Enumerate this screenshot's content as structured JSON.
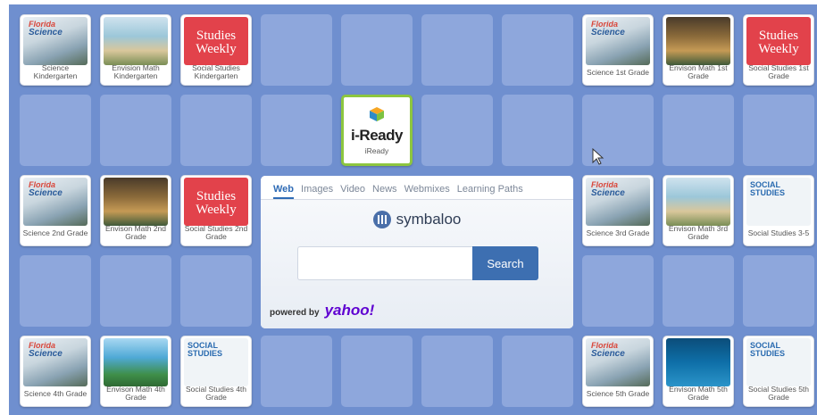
{
  "tiles": {
    "r1c1": {
      "label": "Science Kindergarten",
      "book_brand": "Florida",
      "book_subject": "Science"
    },
    "r1c2": {
      "label": "Envision Math Kindergarten"
    },
    "r1c3": {
      "label": "Social Studies Kindergarten",
      "logo_text": "Studies Weekly"
    },
    "r1c8": {
      "label": "Science 1st Grade",
      "book_brand": "Florida",
      "book_subject": "Science"
    },
    "r1c9": {
      "label": "Envison Math 1st Grade"
    },
    "r1c10": {
      "label": "Social Studies 1st Grade",
      "logo_text": "Studies Weekly"
    },
    "r2c5": {
      "label": "iReady",
      "logo_text": "i-Ready"
    },
    "r3c1": {
      "label": "Science 2nd Grade",
      "book_brand": "Florida",
      "book_subject": "Science"
    },
    "r3c2": {
      "label": "Envison Math 2nd Grade"
    },
    "r3c3": {
      "label": "Social Studies 2nd Grade",
      "logo_text": "Studies Weekly"
    },
    "r3c8": {
      "label": "Science 3rd Grade",
      "book_brand": "Florida",
      "book_subject": "Science"
    },
    "r3c9": {
      "label": "Envison Math 3rd Grade"
    },
    "r3c10": {
      "label": "Social Studies 3-5",
      "book_title": "SOCIAL STUDIES"
    },
    "r5c1": {
      "label": "Science 4th Grade",
      "book_brand": "Florida",
      "book_subject": "Science"
    },
    "r5c2": {
      "label": "Envison Math 4th Grade"
    },
    "r5c3": {
      "label": "Social Studies 4th Grade",
      "book_title": "SOCIAL STUDIES"
    },
    "r5c8": {
      "label": "Science 5th Grade",
      "book_brand": "Florida",
      "book_subject": "Science"
    },
    "r5c9": {
      "label": "Envison Math 5th Grade"
    },
    "r5c10": {
      "label": "Social Studies 5th Grade",
      "book_title": "SOCIAL STUDIES"
    }
  },
  "search": {
    "tabs": [
      "Web",
      "Images",
      "Video",
      "News",
      "Webmixes",
      "Learning Paths"
    ],
    "active_tab": "Web",
    "brand": "symbaloo",
    "input_value": "",
    "button_label": "Search",
    "powered_by": "powered by",
    "provider": "yahoo!"
  },
  "colors": {
    "board_bg": "#6f8fcf",
    "empty_tile": "#8ea7dc",
    "search_button": "#3d6fb1",
    "weekly_red": "#e2424b",
    "yahoo_purple": "#5f01d1"
  }
}
